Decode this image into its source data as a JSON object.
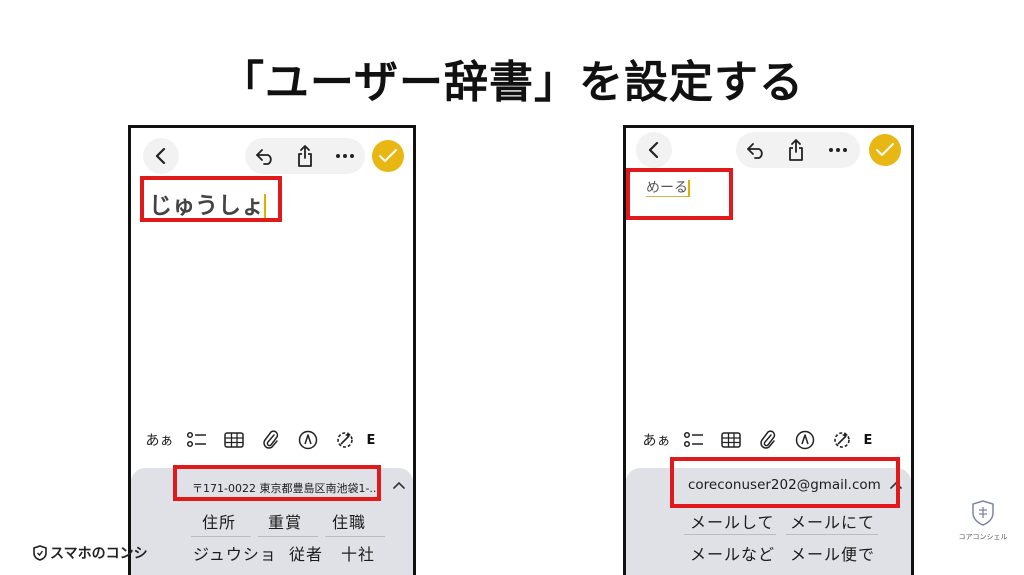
{
  "slide": {
    "title": "「ユーザー辞書」を設定する"
  },
  "left_phone": {
    "typed_text": "じゅうしょ",
    "formatting_bar": {
      "text_style_label": "あぁ",
      "overflow_glyph": "E"
    },
    "suggestion": "〒171-0022 東京都豊島区南池袋1-...",
    "candidates_row1": [
      "住所",
      "重賞",
      "住職"
    ],
    "candidates_row2": [
      "ジュウショ",
      "従者",
      "十社"
    ]
  },
  "right_phone": {
    "typed_text": "めーる",
    "formatting_bar": {
      "text_style_label": "あぁ",
      "overflow_glyph": "E"
    },
    "suggestion": "coreconuser202@gmail.com",
    "candidates_row1": [
      "メールして",
      "メールにて"
    ],
    "candidates_row2": [
      "メールなど",
      "メール便で"
    ]
  },
  "branding": {
    "left_logo_text": "スマホのコンシ",
    "right_logo_text": "コアコンシェル"
  },
  "colors": {
    "highlight": "#e01a1a",
    "accent": "#e8b713",
    "keyboard_bg": "#dfe1e7"
  }
}
